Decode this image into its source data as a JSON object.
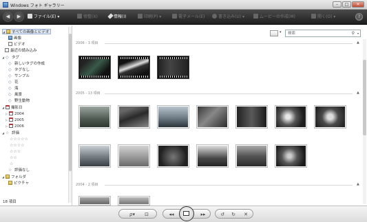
{
  "window": {
    "title": "Windows フォト ギャラリー",
    "buttons": {
      "minimize": "–",
      "maximize": "□",
      "close": "✕"
    }
  },
  "toolbar": {
    "file_label": "ファイル(E) ▾",
    "fix_label": "修整(X)",
    "info_label": "情報(I)",
    "print_label": "印刷(P) ▾",
    "email_label": "電子メール(E)",
    "burn_label": "書き込み(U) ▾",
    "movie_label": "ムービーの作成(M)",
    "open_label": "開く(O) ▾",
    "help_label": "?"
  },
  "sidebar": {
    "items": [
      {
        "label": "すべての画像とビデオ",
        "icon": "folder-photos-icon",
        "selected": true
      },
      {
        "label": "画像",
        "icon": "photo-icon"
      },
      {
        "label": "ビデオ",
        "icon": "video-icon"
      },
      {
        "label": "最近の読み込み",
        "icon": "recent-import-icon"
      },
      {
        "label": "タグ",
        "icon": "tag-icon"
      },
      {
        "label": "新しいタグの作成",
        "icon": "tag-icon"
      },
      {
        "label": "タグなし",
        "icon": "tag-icon"
      },
      {
        "label": "サンプル",
        "icon": "tag-icon"
      },
      {
        "label": "花",
        "icon": "tag-icon"
      },
      {
        "label": "海",
        "icon": "tag-icon"
      },
      {
        "label": "風景",
        "icon": "tag-icon"
      },
      {
        "label": "野生動物",
        "icon": "tag-icon"
      },
      {
        "label": "撮影日",
        "icon": "calendar-icon"
      },
      {
        "label": "2004",
        "icon": "calendar-icon"
      },
      {
        "label": "2005",
        "icon": "calendar-icon"
      },
      {
        "label": "2006",
        "icon": "calendar-icon"
      },
      {
        "label": "評価",
        "icon": "star-icon"
      },
      {
        "label": "☆☆☆☆☆",
        "icon": ""
      },
      {
        "label": "☆☆☆☆",
        "icon": ""
      },
      {
        "label": "☆☆☆",
        "icon": ""
      },
      {
        "label": "☆☆",
        "icon": ""
      },
      {
        "label": "☆",
        "icon": ""
      },
      {
        "label": "評価なし",
        "icon": "star-icon"
      },
      {
        "label": "フォルダ",
        "icon": "folder-icon"
      },
      {
        "label": "ピクチャ",
        "icon": "folder-icon"
      }
    ],
    "status": "18 項目"
  },
  "search": {
    "placeholder": "検索",
    "icon": "search-icon"
  },
  "groups": [
    {
      "label": "2006 - 3 項目",
      "thumbs": 3,
      "type": "video"
    },
    {
      "label": "2005 - 13 項目",
      "thumbs": 13,
      "type": "photo"
    },
    {
      "label": "2004 - 2 項目",
      "thumbs": 2,
      "type": "photo"
    }
  ],
  "bottombar": {
    "zoom": "ρ▾",
    "fit": "⊡",
    "prev": "◂◂",
    "slideshow": "slideshow-icon",
    "next": "▸▸",
    "rotate_left": "↺",
    "rotate_right": "↻",
    "delete": "✕"
  },
  "colors": {
    "toolbar_bg": "#2b2b2b",
    "selection": "#dfe8f5",
    "accent": "#3b6fb3"
  }
}
